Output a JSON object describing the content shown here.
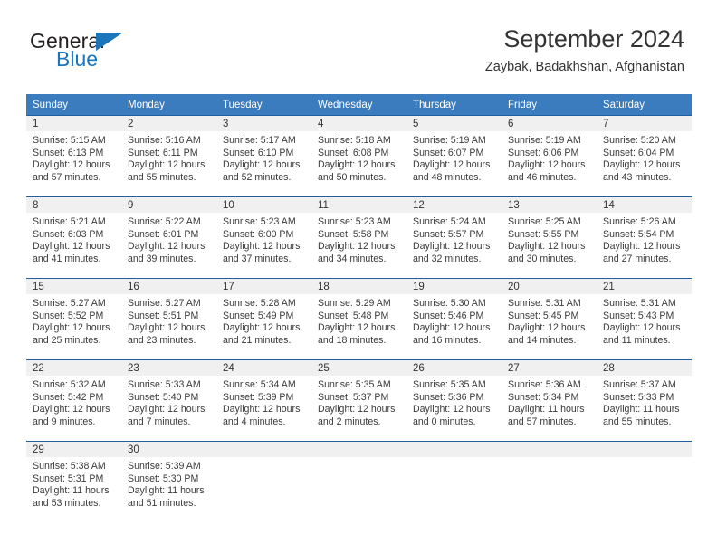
{
  "brand": {
    "word1": "General",
    "word2": "Blue",
    "accent_color": "#1b75bb"
  },
  "header": {
    "title": "September 2024",
    "subtitle": "Zaybak, Badakhshan, Afghanistan"
  },
  "theme": {
    "header_row_background": "#3a7cbe",
    "header_row_text": "#ffffff",
    "day_number_band": "#f0f0f0",
    "row_divider": "#1f5fa0",
    "body_text": "#3a3a3a"
  },
  "weekday_headers": [
    "Sunday",
    "Monday",
    "Tuesday",
    "Wednesday",
    "Thursday",
    "Friday",
    "Saturday"
  ],
  "labels": {
    "sunrise": "Sunrise:",
    "sunset": "Sunset:",
    "daylight": "Daylight:"
  },
  "weeks": [
    [
      {
        "day": "1",
        "sunrise": "Sunrise: 5:15 AM",
        "sunset": "Sunset: 6:13 PM",
        "daylight_a": "Daylight: 12 hours",
        "daylight_b": "and 57 minutes."
      },
      {
        "day": "2",
        "sunrise": "Sunrise: 5:16 AM",
        "sunset": "Sunset: 6:11 PM",
        "daylight_a": "Daylight: 12 hours",
        "daylight_b": "and 55 minutes."
      },
      {
        "day": "3",
        "sunrise": "Sunrise: 5:17 AM",
        "sunset": "Sunset: 6:10 PM",
        "daylight_a": "Daylight: 12 hours",
        "daylight_b": "and 52 minutes."
      },
      {
        "day": "4",
        "sunrise": "Sunrise: 5:18 AM",
        "sunset": "Sunset: 6:08 PM",
        "daylight_a": "Daylight: 12 hours",
        "daylight_b": "and 50 minutes."
      },
      {
        "day": "5",
        "sunrise": "Sunrise: 5:19 AM",
        "sunset": "Sunset: 6:07 PM",
        "daylight_a": "Daylight: 12 hours",
        "daylight_b": "and 48 minutes."
      },
      {
        "day": "6",
        "sunrise": "Sunrise: 5:19 AM",
        "sunset": "Sunset: 6:06 PM",
        "daylight_a": "Daylight: 12 hours",
        "daylight_b": "and 46 minutes."
      },
      {
        "day": "7",
        "sunrise": "Sunrise: 5:20 AM",
        "sunset": "Sunset: 6:04 PM",
        "daylight_a": "Daylight: 12 hours",
        "daylight_b": "and 43 minutes."
      }
    ],
    [
      {
        "day": "8",
        "sunrise": "Sunrise: 5:21 AM",
        "sunset": "Sunset: 6:03 PM",
        "daylight_a": "Daylight: 12 hours",
        "daylight_b": "and 41 minutes."
      },
      {
        "day": "9",
        "sunrise": "Sunrise: 5:22 AM",
        "sunset": "Sunset: 6:01 PM",
        "daylight_a": "Daylight: 12 hours",
        "daylight_b": "and 39 minutes."
      },
      {
        "day": "10",
        "sunrise": "Sunrise: 5:23 AM",
        "sunset": "Sunset: 6:00 PM",
        "daylight_a": "Daylight: 12 hours",
        "daylight_b": "and 37 minutes."
      },
      {
        "day": "11",
        "sunrise": "Sunrise: 5:23 AM",
        "sunset": "Sunset: 5:58 PM",
        "daylight_a": "Daylight: 12 hours",
        "daylight_b": "and 34 minutes."
      },
      {
        "day": "12",
        "sunrise": "Sunrise: 5:24 AM",
        "sunset": "Sunset: 5:57 PM",
        "daylight_a": "Daylight: 12 hours",
        "daylight_b": "and 32 minutes."
      },
      {
        "day": "13",
        "sunrise": "Sunrise: 5:25 AM",
        "sunset": "Sunset: 5:55 PM",
        "daylight_a": "Daylight: 12 hours",
        "daylight_b": "and 30 minutes."
      },
      {
        "day": "14",
        "sunrise": "Sunrise: 5:26 AM",
        "sunset": "Sunset: 5:54 PM",
        "daylight_a": "Daylight: 12 hours",
        "daylight_b": "and 27 minutes."
      }
    ],
    [
      {
        "day": "15",
        "sunrise": "Sunrise: 5:27 AM",
        "sunset": "Sunset: 5:52 PM",
        "daylight_a": "Daylight: 12 hours",
        "daylight_b": "and 25 minutes."
      },
      {
        "day": "16",
        "sunrise": "Sunrise: 5:27 AM",
        "sunset": "Sunset: 5:51 PM",
        "daylight_a": "Daylight: 12 hours",
        "daylight_b": "and 23 minutes."
      },
      {
        "day": "17",
        "sunrise": "Sunrise: 5:28 AM",
        "sunset": "Sunset: 5:49 PM",
        "daylight_a": "Daylight: 12 hours",
        "daylight_b": "and 21 minutes."
      },
      {
        "day": "18",
        "sunrise": "Sunrise: 5:29 AM",
        "sunset": "Sunset: 5:48 PM",
        "daylight_a": "Daylight: 12 hours",
        "daylight_b": "and 18 minutes."
      },
      {
        "day": "19",
        "sunrise": "Sunrise: 5:30 AM",
        "sunset": "Sunset: 5:46 PM",
        "daylight_a": "Daylight: 12 hours",
        "daylight_b": "and 16 minutes."
      },
      {
        "day": "20",
        "sunrise": "Sunrise: 5:31 AM",
        "sunset": "Sunset: 5:45 PM",
        "daylight_a": "Daylight: 12 hours",
        "daylight_b": "and 14 minutes."
      },
      {
        "day": "21",
        "sunrise": "Sunrise: 5:31 AM",
        "sunset": "Sunset: 5:43 PM",
        "daylight_a": "Daylight: 12 hours",
        "daylight_b": "and 11 minutes."
      }
    ],
    [
      {
        "day": "22",
        "sunrise": "Sunrise: 5:32 AM",
        "sunset": "Sunset: 5:42 PM",
        "daylight_a": "Daylight: 12 hours",
        "daylight_b": "and 9 minutes."
      },
      {
        "day": "23",
        "sunrise": "Sunrise: 5:33 AM",
        "sunset": "Sunset: 5:40 PM",
        "daylight_a": "Daylight: 12 hours",
        "daylight_b": "and 7 minutes."
      },
      {
        "day": "24",
        "sunrise": "Sunrise: 5:34 AM",
        "sunset": "Sunset: 5:39 PM",
        "daylight_a": "Daylight: 12 hours",
        "daylight_b": "and 4 minutes."
      },
      {
        "day": "25",
        "sunrise": "Sunrise: 5:35 AM",
        "sunset": "Sunset: 5:37 PM",
        "daylight_a": "Daylight: 12 hours",
        "daylight_b": "and 2 minutes."
      },
      {
        "day": "26",
        "sunrise": "Sunrise: 5:35 AM",
        "sunset": "Sunset: 5:36 PM",
        "daylight_a": "Daylight: 12 hours",
        "daylight_b": "and 0 minutes."
      },
      {
        "day": "27",
        "sunrise": "Sunrise: 5:36 AM",
        "sunset": "Sunset: 5:34 PM",
        "daylight_a": "Daylight: 11 hours",
        "daylight_b": "and 57 minutes."
      },
      {
        "day": "28",
        "sunrise": "Sunrise: 5:37 AM",
        "sunset": "Sunset: 5:33 PM",
        "daylight_a": "Daylight: 11 hours",
        "daylight_b": "and 55 minutes."
      }
    ],
    [
      {
        "day": "29",
        "sunrise": "Sunrise: 5:38 AM",
        "sunset": "Sunset: 5:31 PM",
        "daylight_a": "Daylight: 11 hours",
        "daylight_b": "and 53 minutes."
      },
      {
        "day": "30",
        "sunrise": "Sunrise: 5:39 AM",
        "sunset": "Sunset: 5:30 PM",
        "daylight_a": "Daylight: 11 hours",
        "daylight_b": "and 51 minutes."
      },
      {
        "day": "",
        "sunrise": "",
        "sunset": "",
        "daylight_a": "",
        "daylight_b": ""
      },
      {
        "day": "",
        "sunrise": "",
        "sunset": "",
        "daylight_a": "",
        "daylight_b": ""
      },
      {
        "day": "",
        "sunrise": "",
        "sunset": "",
        "daylight_a": "",
        "daylight_b": ""
      },
      {
        "day": "",
        "sunrise": "",
        "sunset": "",
        "daylight_a": "",
        "daylight_b": ""
      },
      {
        "day": "",
        "sunrise": "",
        "sunset": "",
        "daylight_a": "",
        "daylight_b": ""
      }
    ]
  ]
}
